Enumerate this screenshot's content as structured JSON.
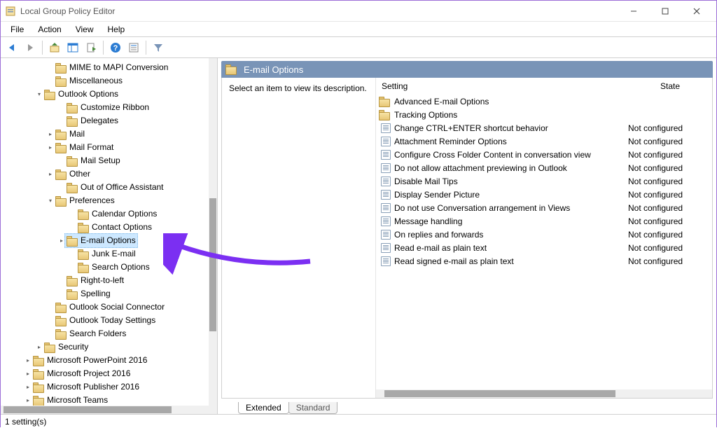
{
  "window": {
    "title": "Local Group Policy Editor"
  },
  "menu": {
    "items": [
      "File",
      "Action",
      "View",
      "Help"
    ]
  },
  "tree": {
    "nodes": [
      {
        "indent": 4,
        "expander": "",
        "label": "MIME to MAPI Conversion"
      },
      {
        "indent": 4,
        "expander": "",
        "label": "Miscellaneous"
      },
      {
        "indent": 3,
        "expander": "v",
        "label": "Outlook Options"
      },
      {
        "indent": 5,
        "expander": "",
        "label": "Customize Ribbon"
      },
      {
        "indent": 5,
        "expander": "",
        "label": "Delegates"
      },
      {
        "indent": 4,
        "expander": ">",
        "label": "Mail"
      },
      {
        "indent": 4,
        "expander": ">",
        "label": "Mail Format"
      },
      {
        "indent": 5,
        "expander": "",
        "label": "Mail Setup"
      },
      {
        "indent": 4,
        "expander": ">",
        "label": "Other"
      },
      {
        "indent": 5,
        "expander": "",
        "label": "Out of Office Assistant"
      },
      {
        "indent": 4,
        "expander": "v",
        "label": "Preferences"
      },
      {
        "indent": 6,
        "expander": "",
        "label": "Calendar Options"
      },
      {
        "indent": 6,
        "expander": "",
        "label": "Contact Options"
      },
      {
        "indent": 5,
        "expander": ">",
        "label": "E-mail Options",
        "selected": true
      },
      {
        "indent": 6,
        "expander": "",
        "label": "Junk E-mail"
      },
      {
        "indent": 6,
        "expander": "",
        "label": "Search Options"
      },
      {
        "indent": 5,
        "expander": "",
        "label": "Right-to-left"
      },
      {
        "indent": 5,
        "expander": "",
        "label": "Spelling"
      },
      {
        "indent": 4,
        "expander": "",
        "label": "Outlook Social Connector"
      },
      {
        "indent": 4,
        "expander": "",
        "label": "Outlook Today Settings"
      },
      {
        "indent": 4,
        "expander": "",
        "label": "Search Folders"
      },
      {
        "indent": 3,
        "expander": ">",
        "label": "Security"
      },
      {
        "indent": 2,
        "expander": ">",
        "label": "Microsoft PowerPoint 2016"
      },
      {
        "indent": 2,
        "expander": ">",
        "label": "Microsoft Project 2016"
      },
      {
        "indent": 2,
        "expander": ">",
        "label": "Microsoft Publisher 2016"
      },
      {
        "indent": 2,
        "expander": ">",
        "label": "Microsoft Teams"
      }
    ]
  },
  "rightpanel": {
    "title": "E-mail Options",
    "description_prompt": "Select an item to view its description.",
    "columns": {
      "setting": "Setting",
      "state": "State"
    },
    "rows": [
      {
        "type": "folder",
        "setting": "Advanced E-mail Options",
        "state": ""
      },
      {
        "type": "folder",
        "setting": "Tracking Options",
        "state": ""
      },
      {
        "type": "policy",
        "setting": "Change CTRL+ENTER shortcut behavior",
        "state": "Not configured"
      },
      {
        "type": "policy",
        "setting": "Attachment Reminder Options",
        "state": "Not configured"
      },
      {
        "type": "policy",
        "setting": "Configure Cross Folder Content in conversation view",
        "state": "Not configured"
      },
      {
        "type": "policy",
        "setting": "Do not allow attachment previewing in Outlook",
        "state": "Not configured"
      },
      {
        "type": "policy",
        "setting": "Disable Mail Tips",
        "state": "Not configured"
      },
      {
        "type": "policy",
        "setting": "Display Sender Picture",
        "state": "Not configured"
      },
      {
        "type": "policy",
        "setting": "Do not use Conversation arrangement in Views",
        "state": "Not configured"
      },
      {
        "type": "policy",
        "setting": "Message handling",
        "state": "Not configured"
      },
      {
        "type": "policy",
        "setting": "On replies and forwards",
        "state": "Not configured"
      },
      {
        "type": "policy",
        "setting": "Read e-mail as plain text",
        "state": "Not configured"
      },
      {
        "type": "policy",
        "setting": "Read signed e-mail as plain text",
        "state": "Not configured"
      }
    ],
    "tabs": {
      "extended": "Extended",
      "standard": "Standard"
    }
  },
  "statusbar": {
    "text": "1 setting(s)"
  }
}
